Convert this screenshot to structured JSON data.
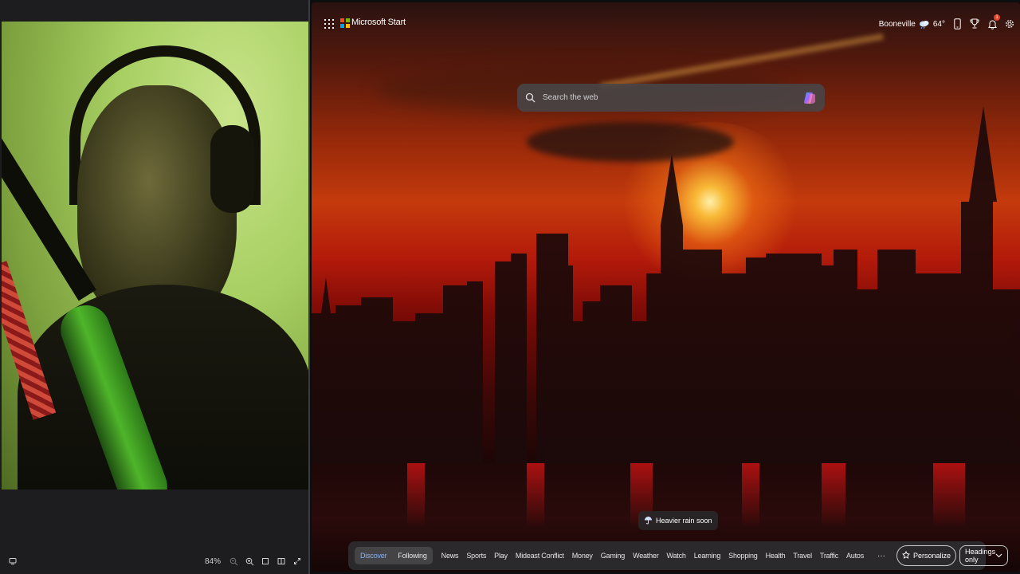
{
  "left_pane": {
    "toolbar": {
      "zoom_label": "84%"
    }
  },
  "browser": {
    "brand_name": "Microsoft Start",
    "brand_colors": [
      "#f25022",
      "#7fba00",
      "#00a4ef",
      "#ffb900"
    ],
    "location": "Booneville",
    "temperature": "64°",
    "notification_count": "1",
    "search": {
      "placeholder": "Search the web"
    },
    "weather_alert": "Heavier rain soon",
    "nav": {
      "tabs": [
        {
          "label": "Discover",
          "active": true
        },
        {
          "label": "Following"
        },
        {
          "label": "News"
        },
        {
          "label": "Sports"
        },
        {
          "label": "Play"
        },
        {
          "label": "Mideast Conflict"
        },
        {
          "label": "Money"
        },
        {
          "label": "Gaming"
        },
        {
          "label": "Weather"
        },
        {
          "label": "Watch"
        },
        {
          "label": "Learning"
        },
        {
          "label": "Shopping"
        },
        {
          "label": "Health"
        },
        {
          "label": "Travel"
        },
        {
          "label": "Traffic"
        },
        {
          "label": "Autos"
        }
      ],
      "more_label": "···",
      "personalize_label": "Personalize",
      "headings_select_value": "Headings only"
    },
    "accent_color": "#7fb3ff"
  }
}
